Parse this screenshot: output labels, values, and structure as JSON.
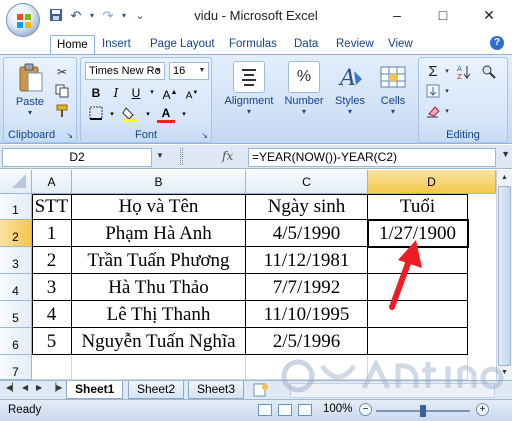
{
  "window": {
    "title": "vidu - Microsoft Excel",
    "minimize": "–",
    "maximize": "□",
    "close": "✕"
  },
  "qat": {
    "save_icon": "save-icon",
    "undo_icon": "undo-icon",
    "redo_icon": "redo-icon",
    "more": "⌄"
  },
  "tabs": [
    "Home",
    "Insert",
    "Page Layout",
    "Formulas",
    "Data",
    "Review",
    "View"
  ],
  "ribbon": {
    "clipboard": {
      "label": "Clipboard",
      "paste": "Paste"
    },
    "font": {
      "label": "Font",
      "name": "Times New Ro",
      "size": "16"
    },
    "alignment": {
      "label": "Alignment"
    },
    "number": {
      "label": "Number"
    },
    "styles": {
      "label": "Styles"
    },
    "cells": {
      "label": "Cells"
    },
    "editing": {
      "label": "Editing"
    }
  },
  "formula_bar": {
    "name_box": "D2",
    "fx": "fx",
    "formula": "=YEAR(NOW())-YEAR(C2)"
  },
  "columns": [
    "A",
    "B",
    "C",
    "D"
  ],
  "rows": [
    "1",
    "2",
    "3",
    "4",
    "5",
    "6",
    "7"
  ],
  "table": {
    "headers": [
      "STT",
      "Họ và Tên",
      "Ngày sinh",
      "Tuổi"
    ],
    "data": [
      [
        "1",
        "Phạm Hà Anh",
        "4/5/1990",
        "1/27/1900"
      ],
      [
        "2",
        "Trần Tuấn Phương",
        "11/12/1981",
        ""
      ],
      [
        "3",
        "Hà Thu Thảo",
        "7/7/1992",
        ""
      ],
      [
        "4",
        "Lê Thị Thanh",
        "11/10/1995",
        ""
      ],
      [
        "5",
        "Nguyễn Tuấn Nghĩa",
        "2/5/1996",
        ""
      ]
    ]
  },
  "sheets": [
    "Sheet1",
    "Sheet2",
    "Sheet3"
  ],
  "active_sheet": "Sheet1",
  "status": {
    "ready": "Ready",
    "zoom": "100%"
  },
  "colors": {
    "arrow": "#ee1c24",
    "selected_header": "#f5c74a",
    "ribbon_text": "#15428b"
  }
}
